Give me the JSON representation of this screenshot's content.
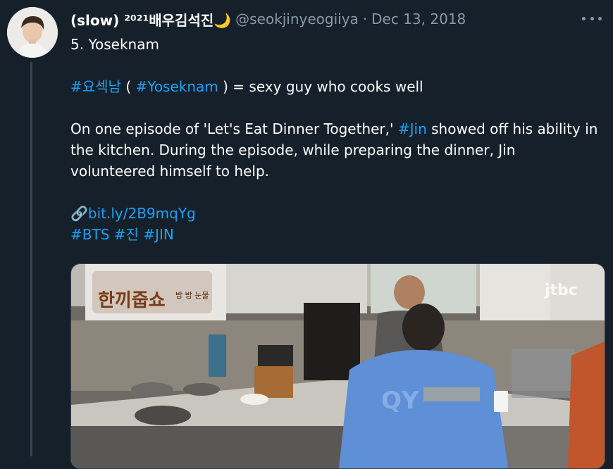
{
  "tweet": {
    "display_name": "(slow) ²⁰²¹배우김석진🌙",
    "handle": "@seokjinyeogiiya",
    "separator": "·",
    "date": "Dec 13, 2018",
    "more_icon": "more-horizontal-icon",
    "lines": {
      "heading": "5. Yoseknam",
      "hashtag_korean": "#요섹남",
      "paren_open": " ( ",
      "hashtag_yoseknam": "#Yoseknam",
      "definition": " ) = sexy guy who cooks well",
      "para_start": "On one episode of 'Let's Eat Dinner Together,' ",
      "hashtag_jin": "#Jin",
      "para_end": " showed off his ability in the kitchen. During the episode, while preparing the dinner, Jin volunteered himself to help.",
      "link_icon": "🔗",
      "link_text": "bit.ly/2B9mqYg",
      "tag_bts": "#BTS",
      "tag_jin_kr": "#진",
      "tag_jin_en": "#JIN"
    },
    "media": {
      "show_logo_text": "한끼줍쇼",
      "show_sub_text": "밥 밥 눈물",
      "channel_watermark": "jtbc",
      "shirt_text": "QY"
    }
  }
}
